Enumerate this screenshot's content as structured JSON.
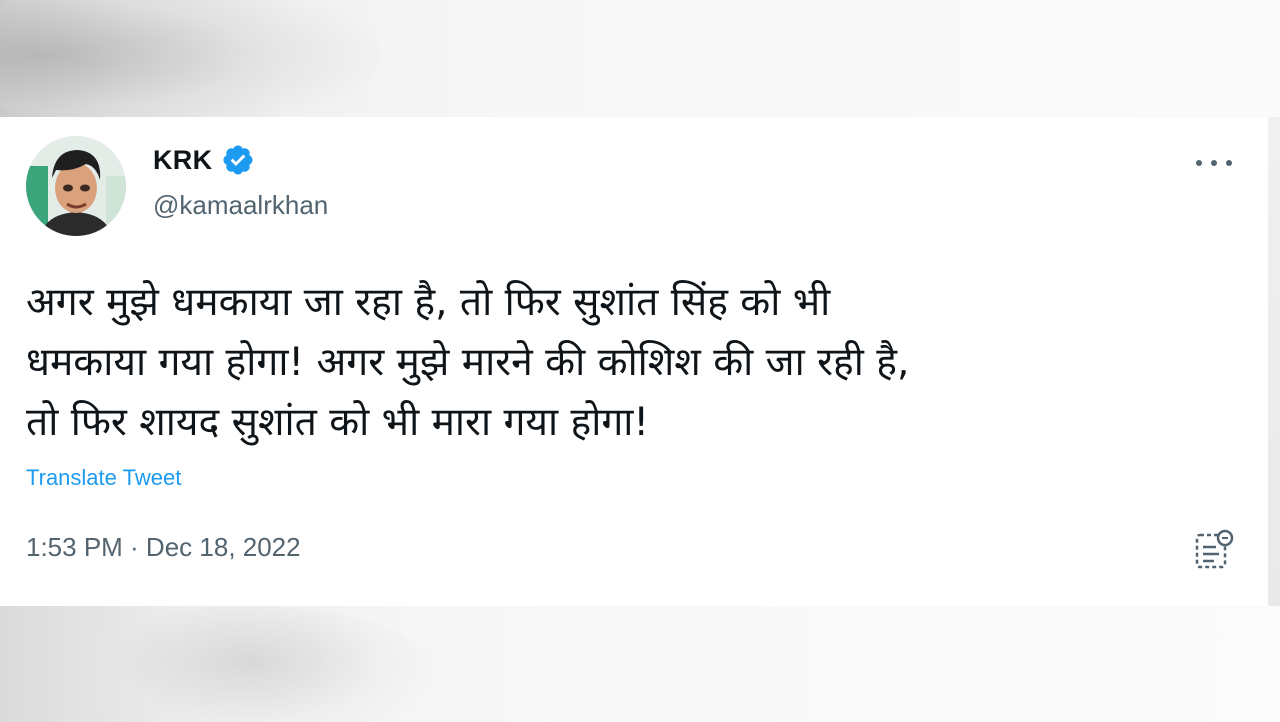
{
  "tweet": {
    "display_name": "KRK",
    "handle": "@kamaalrkhan",
    "verified_icon": "verified-badge-icon",
    "text": "अगर मुझे धमकाया जा रहा है, तो फिर सुशांत सिंह को भी\nधमकाया गया होगा! अगर मुझे मारने की कोशिश की जा रही है,\nतो फिर शायद सुशांत को भी मारा गया होगा!",
    "translate_label": "Translate Tweet",
    "timestamp": "1:53 PM · Dec 18, 2022",
    "more_icon": "more-options-icon",
    "analytics_icon": "view-analytics-icon"
  },
  "colors": {
    "text_primary": "#0f1419",
    "text_secondary": "#536471",
    "accent": "#1d9bf0"
  }
}
